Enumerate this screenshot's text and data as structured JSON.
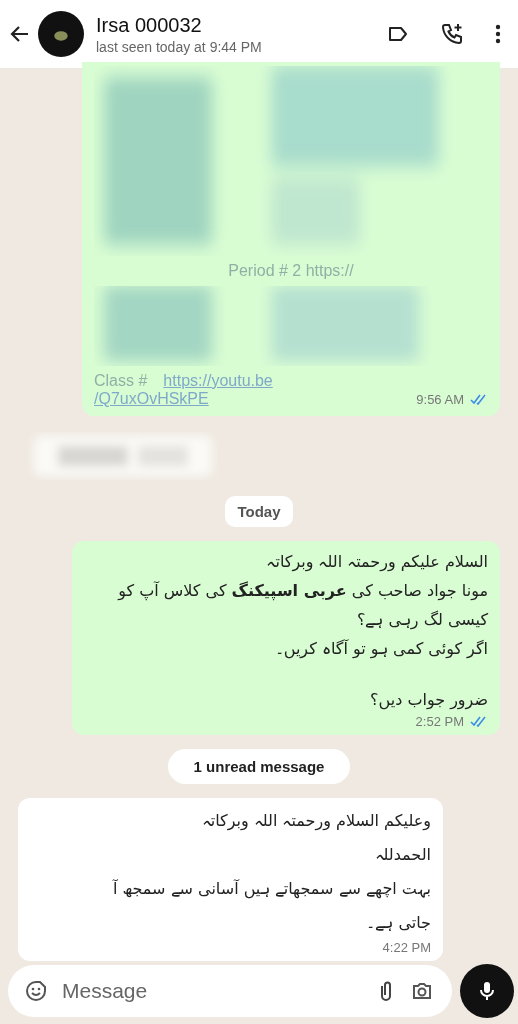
{
  "header": {
    "contact_name": "Irsa 000032",
    "status": "last seen today at 9:44 PM"
  },
  "messages": [
    {
      "kind": "blurred_outgoing",
      "lines": [
        "Period # 2 https://",
        "Class #",
        "https://youtu.be",
        "/Q7uxOvHSkPE"
      ],
      "time": "9:56 AM",
      "read": true
    },
    {
      "kind": "blurred_incoming"
    },
    {
      "kind": "date",
      "text": "Today"
    },
    {
      "kind": "outgoing",
      "lines": [
        "السلام علیکم ورحمتہ اللہ وبرکاتہ",
        "مونا جواد صاحب کی **عربی اسپیکنگ** کی کلاس آپ کو کیسی لگ رہی ہے؟",
        "اگر کوئی کمی ہو تو آگاہ کریں۔"
      ],
      "after_gap": [
        "ضرور جواب دیں؟"
      ],
      "time": "2:52 PM",
      "read": true
    },
    {
      "kind": "unread",
      "text": "1 unread message"
    },
    {
      "kind": "incoming",
      "lines": [
        "وعلیکم السلام ورحمتہ اللہ وبرکاتہ",
        "الحمدللہ",
        "بہت اچھے سے سمجھاتے ہیں آسانی سے سمجھ آ جاتی ہے۔"
      ],
      "time": "4:22 PM"
    }
  ],
  "composer": {
    "placeholder": "Message"
  }
}
